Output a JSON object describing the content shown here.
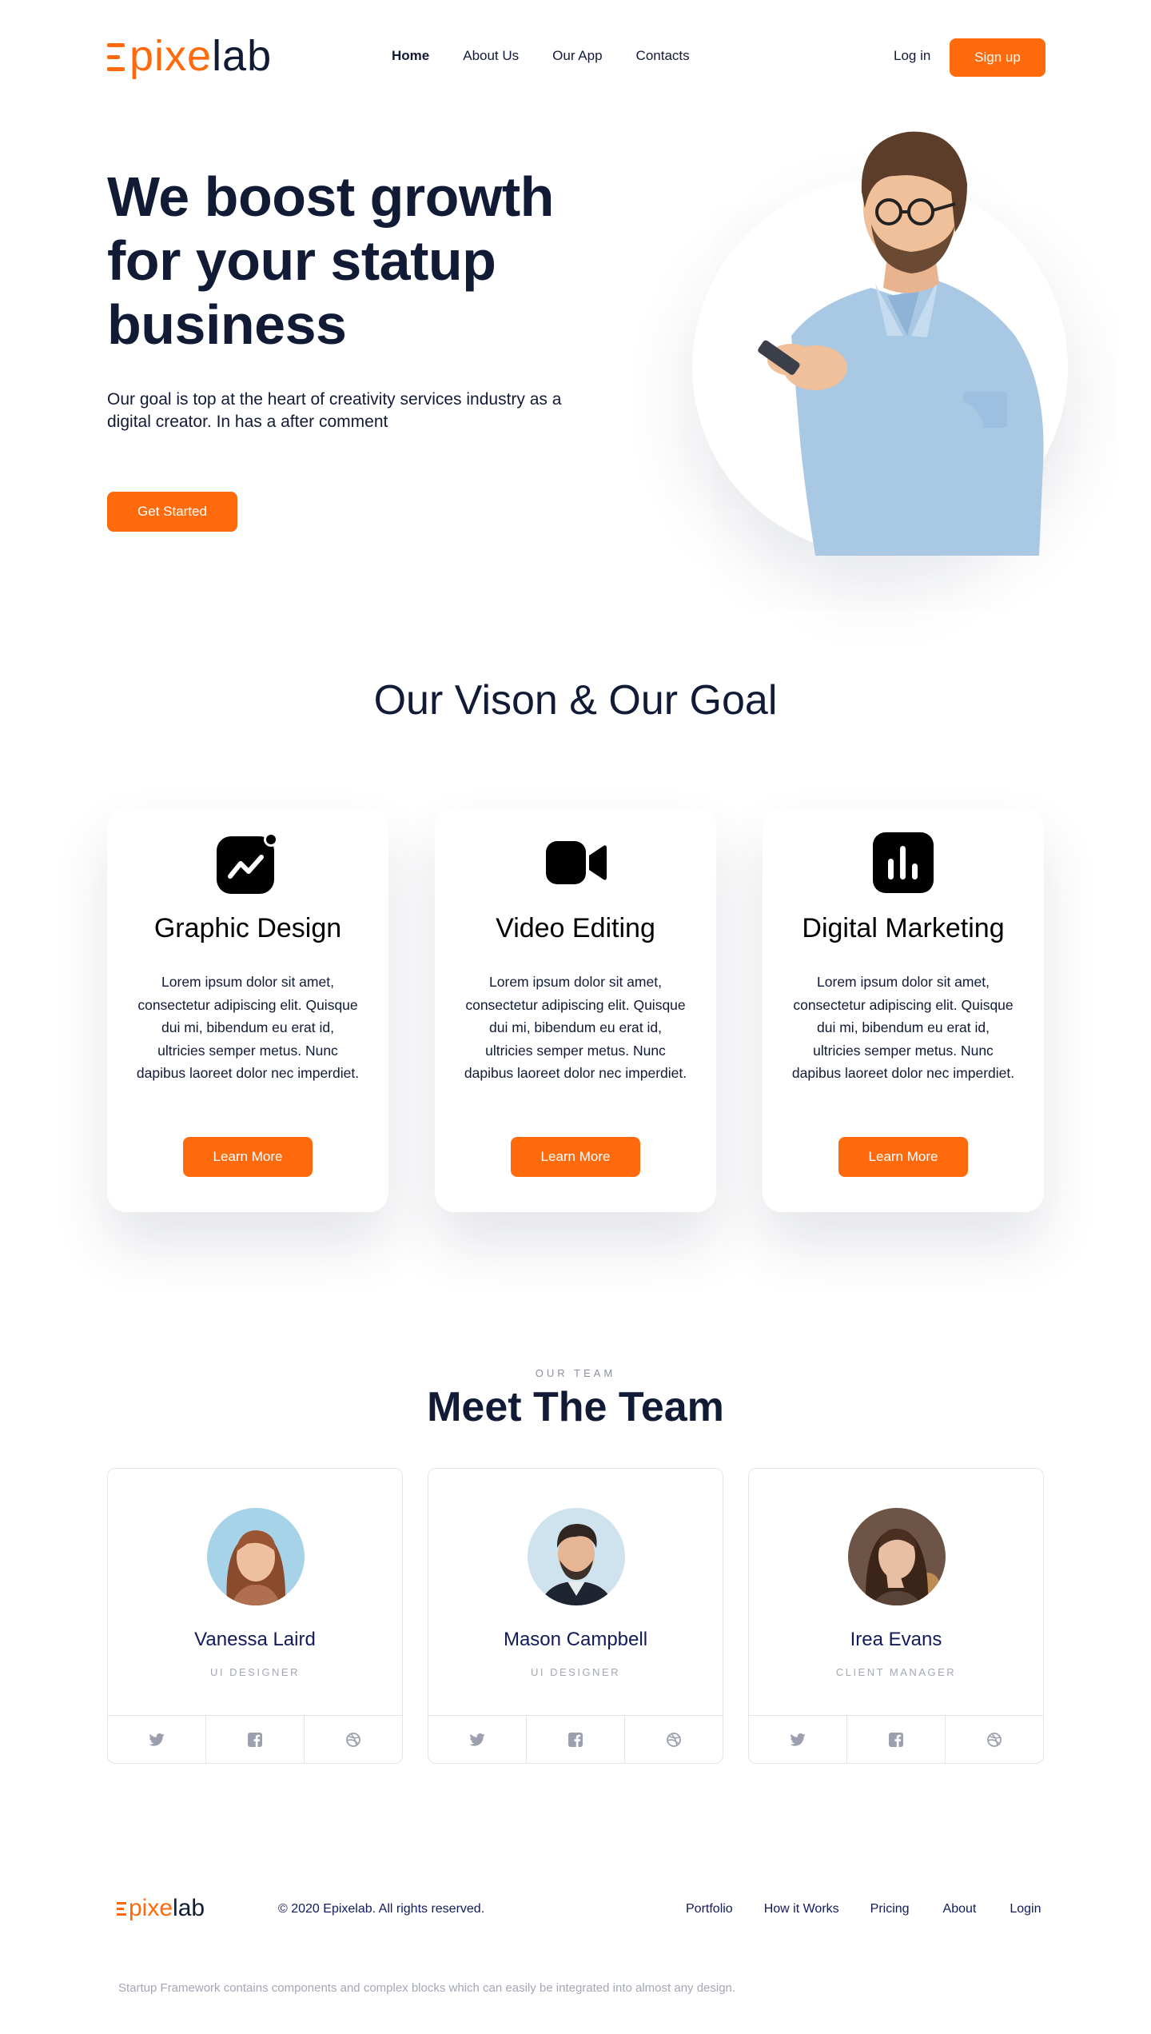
{
  "brand": {
    "logo_accent": "pixe",
    "logo_rest": "lab",
    "accent_color": "#ff6a0c",
    "dark_color": "#111b36"
  },
  "nav": {
    "items": [
      {
        "label": "Home",
        "active": true
      },
      {
        "label": "About Us"
      },
      {
        "label": "Our App"
      },
      {
        "label": "Contacts"
      }
    ],
    "login_label": "Log in",
    "signup_label": "Sign up"
  },
  "hero": {
    "title": "We boost growth for your statup business",
    "subtitle": "Our goal is top at the heart of creativity services industry as a digital creator. In has a after comment",
    "cta_label": "Get Started"
  },
  "vision": {
    "title": "Our Vison & Our Goal",
    "cards": [
      {
        "icon": "growth-chart-icon",
        "title": "Graphic Design",
        "text": "Lorem ipsum dolor sit amet, consectetur adipiscing elit. Quisque dui mi, bibendum eu erat id, ultricies semper metus. Nunc dapibus laoreet dolor nec imperdiet.",
        "button": "Learn More"
      },
      {
        "icon": "video-camera-icon",
        "title": "Video Editing",
        "text": "Lorem ipsum dolor sit amet, consectetur adipiscing elit. Quisque dui mi, bibendum eu erat id, ultricies semper metus. Nunc dapibus laoreet dolor nec imperdiet.",
        "button": "Learn More"
      },
      {
        "icon": "bar-chart-icon",
        "title": "Digital Marketing",
        "text": "Lorem ipsum dolor sit amet, consectetur adipiscing elit. Quisque dui mi, bibendum eu erat id, ultricies semper metus. Nunc dapibus laoreet dolor nec imperdiet.",
        "button": "Learn More"
      }
    ]
  },
  "team": {
    "eyebrow": "OUR TEAM",
    "title": "Meet The Team",
    "members": [
      {
        "name": "Vanessa Laird",
        "role": "UI DESIGNER"
      },
      {
        "name": "Mason Campbell",
        "role": "UI DESIGNER"
      },
      {
        "name": "Irea Evans",
        "role": "CLIENT MANAGER"
      }
    ],
    "social_icons": [
      "twitter-icon",
      "facebook-icon",
      "dribbble-icon"
    ]
  },
  "footer": {
    "logo_accent": "pixe",
    "logo_rest": "lab",
    "copyright": "© 2020 Epixelab. All rights reserved.",
    "links": [
      "Portfolio",
      "How it Works",
      "Pricing",
      "About",
      "Login"
    ],
    "footnote": "Startup Framework contains components and complex blocks which can easily be integrated into almost any design."
  }
}
